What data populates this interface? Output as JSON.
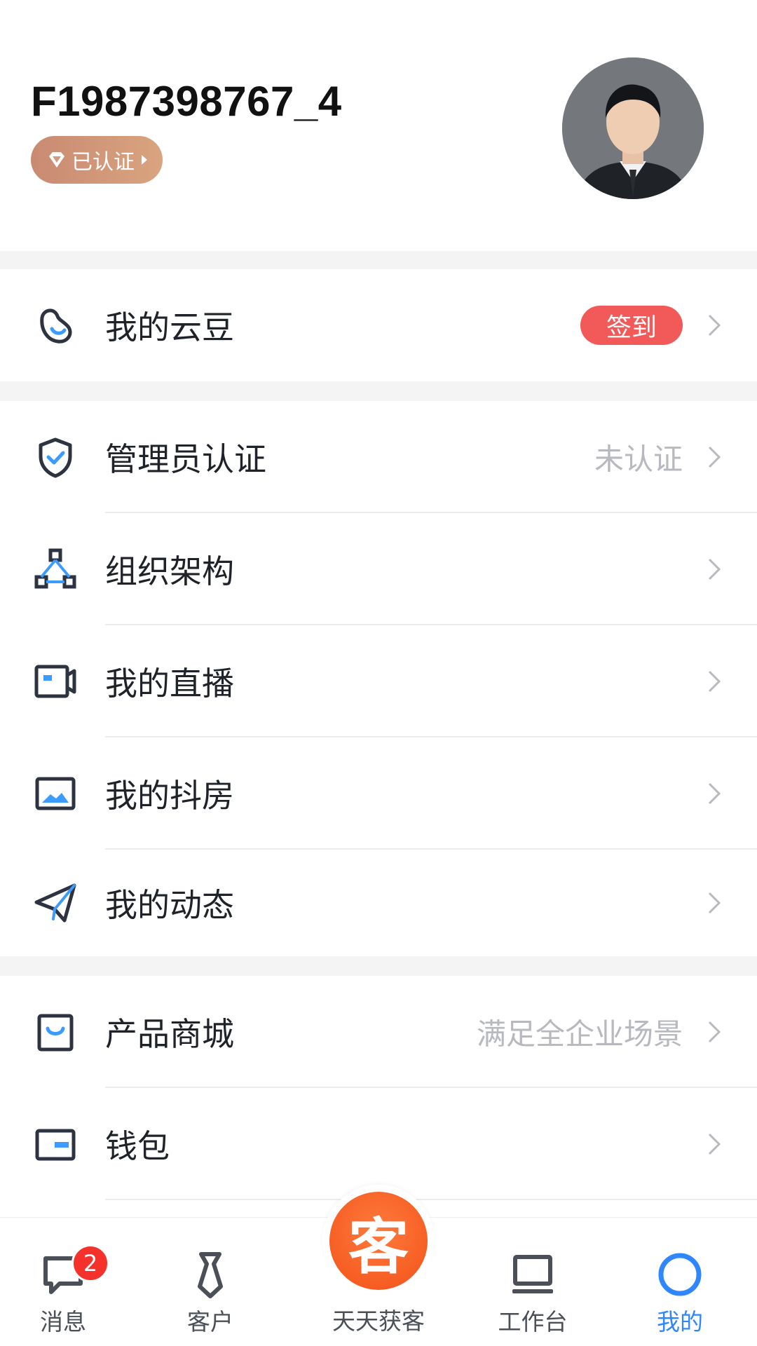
{
  "profile": {
    "username": "F1987398767_4",
    "verified_label": "已认证"
  },
  "menu": {
    "yundou": {
      "label": "我的云豆",
      "action": "签到"
    },
    "admin_cert": {
      "label": "管理员认证",
      "value": "未认证"
    },
    "org": {
      "label": "组织架构"
    },
    "live": {
      "label": "我的直播"
    },
    "doufang": {
      "label": "我的抖房"
    },
    "moments": {
      "label": "我的动态"
    },
    "shop": {
      "label": "产品商城",
      "value": "满足全企业场景"
    },
    "wallet": {
      "label": "钱包"
    }
  },
  "tabs": {
    "messages": {
      "label": "消息",
      "badge": "2"
    },
    "customers": {
      "label": "客户"
    },
    "center": {
      "icon_text": "客",
      "label": "天天获客"
    },
    "workbench": {
      "label": "工作台"
    },
    "me": {
      "label": "我的"
    }
  },
  "colors": {
    "accent": "#2f86ff",
    "checkin": "#f25a5a",
    "center_button": "#f55a1f",
    "badge_gradient_start": "#c98a72",
    "badge_gradient_end": "#d9a47f"
  },
  "icons": {
    "yundou": "bean-icon",
    "admin_cert": "shield-check-icon",
    "org": "org-chart-icon",
    "live": "video-camera-icon",
    "doufang": "image-icon",
    "moments": "paper-plane-icon",
    "shop": "shopping-bag-icon",
    "wallet": "wallet-icon"
  }
}
